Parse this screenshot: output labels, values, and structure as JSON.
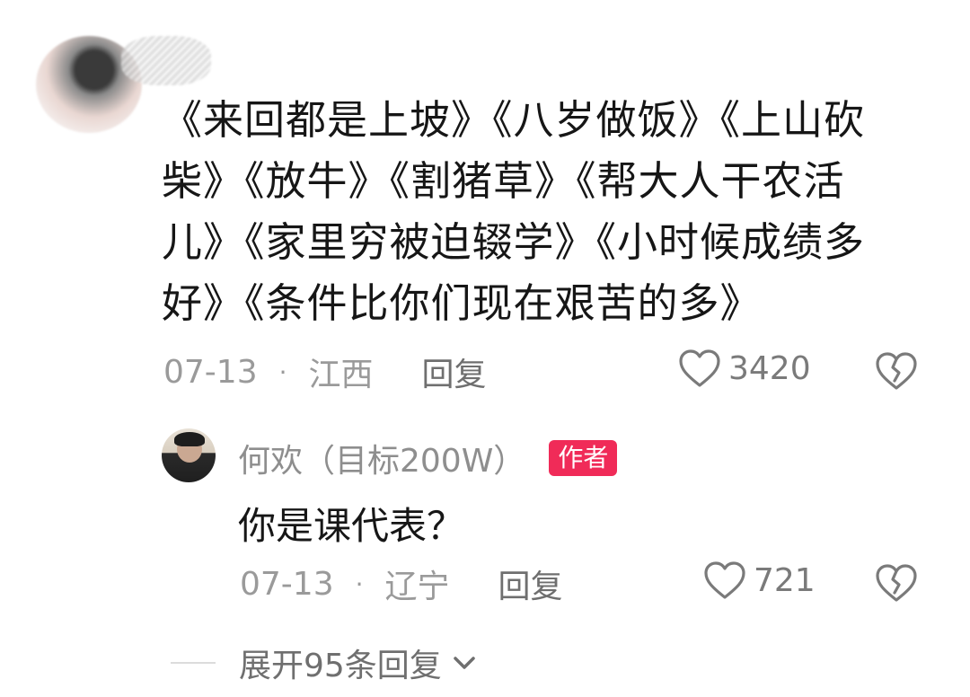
{
  "comment": {
    "text": "《来回都是上坡》《八岁做饭》《上山砍柴》《放牛》《割猪草》《帮大人干农活儿》《家里穷被迫辍学》《小时候成绩多好》《条件比你们现在艰苦的多》",
    "date": "07-13",
    "separator": "·",
    "location": "江西",
    "reply_label": "回复",
    "likes": "3420"
  },
  "reply": {
    "author": "何欢（目标200W）",
    "badge": "作者",
    "text": "你是课代表？",
    "date": "07-13",
    "separator": "·",
    "location": "辽宁",
    "reply_label": "回复",
    "likes": "721"
  },
  "expand": {
    "label": "展开95条回复"
  },
  "icons": {
    "like": "heart-outline-icon",
    "dislike": "broken-heart-icon",
    "expand": "chevron-down-icon"
  },
  "colors": {
    "badge": "#f02b58",
    "meta": "#9a9a9a",
    "text": "#161616"
  }
}
